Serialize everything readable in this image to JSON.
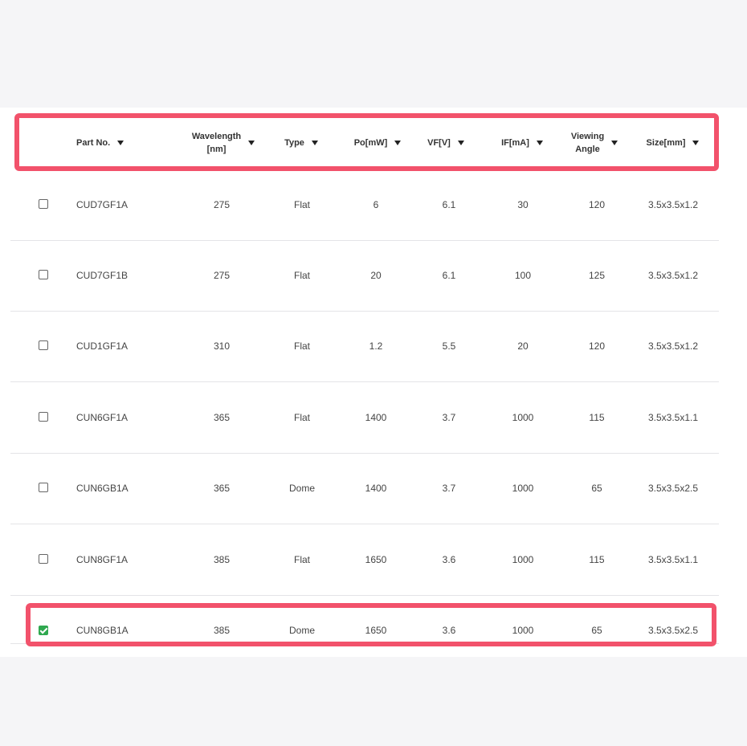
{
  "table": {
    "columns": [
      {
        "label": "Part No.",
        "sortable": true
      },
      {
        "label": "Wavelength [nm]",
        "line1": "Wavelength",
        "line2": "[nm]",
        "sortable": true
      },
      {
        "label": "Type",
        "sortable": true
      },
      {
        "label": "Po[mW]",
        "sortable": true
      },
      {
        "label": "VF[V]",
        "sortable": true
      },
      {
        "label": "IF[mA]",
        "sortable": true
      },
      {
        "label": "Viewing Angle",
        "line1": "Viewing",
        "line2": "Angle",
        "sortable": true
      },
      {
        "label": "Size[mm]",
        "sortable": true
      }
    ],
    "rows": [
      {
        "checked": false,
        "part": "CUD7GF1A",
        "wavelength": "275",
        "type": "Flat",
        "po": "6",
        "vf": "6.1",
        "if": "30",
        "angle": "120",
        "size": "3.5x3.5x1.2"
      },
      {
        "checked": false,
        "part": "CUD7GF1B",
        "wavelength": "275",
        "type": "Flat",
        "po": "20",
        "vf": "6.1",
        "if": "100",
        "angle": "125",
        "size": "3.5x3.5x1.2"
      },
      {
        "checked": false,
        "part": "CUD1GF1A",
        "wavelength": "310",
        "type": "Flat",
        "po": "1.2",
        "vf": "5.5",
        "if": "20",
        "angle": "120",
        "size": "3.5x3.5x1.2"
      },
      {
        "checked": false,
        "part": "CUN6GF1A",
        "wavelength": "365",
        "type": "Flat",
        "po": "1400",
        "vf": "3.7",
        "if": "1000",
        "angle": "115",
        "size": "3.5x3.5x1.1"
      },
      {
        "checked": false,
        "part": "CUN6GB1A",
        "wavelength": "365",
        "type": "Dome",
        "po": "1400",
        "vf": "3.7",
        "if": "1000",
        "angle": "65",
        "size": "3.5x3.5x2.5"
      },
      {
        "checked": false,
        "part": "CUN8GF1A",
        "wavelength": "385",
        "type": "Flat",
        "po": "1650",
        "vf": "3.6",
        "if": "1000",
        "angle": "115",
        "size": "3.5x3.5x1.1"
      },
      {
        "checked": true,
        "part": "CUN8GB1A",
        "wavelength": "385",
        "type": "Dome",
        "po": "1650",
        "vf": "3.6",
        "if": "1000",
        "angle": "65",
        "size": "3.5x3.5x2.5"
      }
    ]
  },
  "colors": {
    "highlight": "#f2526b",
    "checked": "#2fa84f"
  }
}
